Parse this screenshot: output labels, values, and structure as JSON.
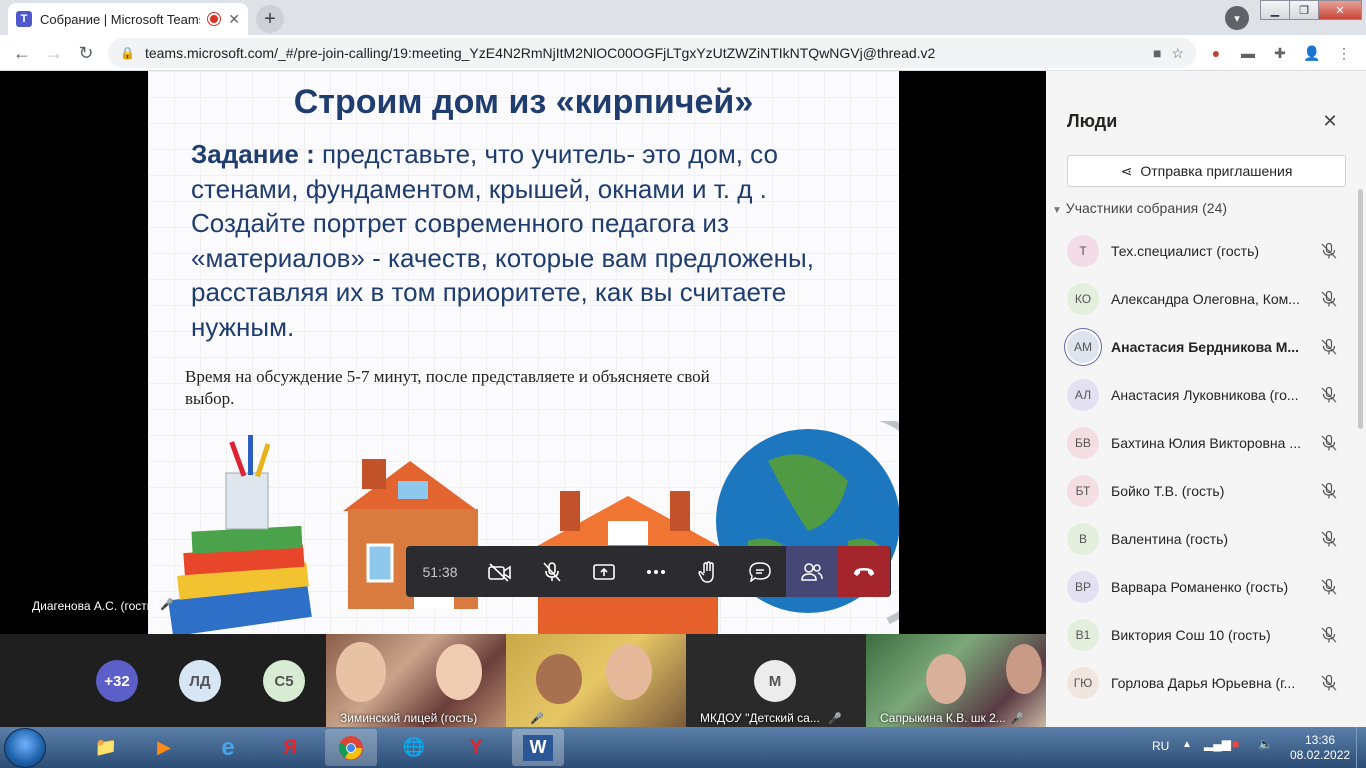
{
  "browser": {
    "tab_title": "Собрание | Microsoft Teams",
    "tab_favicon_letter": "T",
    "url": "teams.microsoft.com/_#/pre-join-calling/19:meeting_YzE4N2RmNjItM2NlOC00OGFjLTgxYzUtZWZiNTIkNTQwNGVj@thread.v2"
  },
  "slide": {
    "title": "Строим дом из «кирпичей»",
    "task_label": "Задание :",
    "task_text": " представьте, что учитель- это дом, со стенами, фундаментом, крышей, окнами и т. д . Создайте портрет современного педагога из «материалов» - качеств, которые вам предложены, расставляя их в том приоритете, как вы считаете нужным.",
    "time_note": "Время на обсуждение 5-7 минут, после представляете и объясняете свой выбор."
  },
  "presenter": {
    "name": "Диагенова А.С. (гость)"
  },
  "controls": {
    "timer": "51:38"
  },
  "tiles": {
    "overflow": "+32",
    "avatar1": "ЛД",
    "avatar2": "С5",
    "video1_name": "Зиминский лицей (гость)",
    "avatar3": "М",
    "avatar3_name": "МКДОУ \"Детский са...",
    "video3_name": "Сапрыкина К.В. шк 2..."
  },
  "panel": {
    "title": "Люди",
    "invite_label": "Отправка приглашения",
    "participants_header": "Участники собрания (24)",
    "participants": [
      {
        "initials": "Т",
        "name": "Тех.специалист (гость)",
        "color": "#f3dce7",
        "bold": false
      },
      {
        "initials": "КО",
        "name": "Александра Олеговна, Ком...",
        "color": "#e4eedd",
        "bold": false
      },
      {
        "initials": "АМ",
        "name": "Анастасия Бердникова М...",
        "color": "#dde4ee",
        "bold": true
      },
      {
        "initials": "АЛ",
        "name": "Анастасия Луковникова (го...",
        "color": "#e3e1f1",
        "bold": false
      },
      {
        "initials": "БВ",
        "name": "Бахтина Юлия Викторовна ...",
        "color": "#f4dde3",
        "bold": false
      },
      {
        "initials": "БТ",
        "name": "Бойко Т.В. (гость)",
        "color": "#f4dde3",
        "bold": false
      },
      {
        "initials": "В",
        "name": "Валентина (гость)",
        "color": "#e4eedd",
        "bold": false
      },
      {
        "initials": "ВР",
        "name": "Варвара Романенко (гость)",
        "color": "#e3e1f1",
        "bold": false
      },
      {
        "initials": "В1",
        "name": "Виктория Сош 10 (гость)",
        "color": "#e4eedd",
        "bold": false
      },
      {
        "initials": "ГЮ",
        "name": "Горлова Дарья Юрьевна (г...",
        "color": "#f1e6df",
        "bold": false
      }
    ]
  },
  "taskbar": {
    "lang": "RU",
    "time": "13:36",
    "date": "08.02.2022"
  }
}
